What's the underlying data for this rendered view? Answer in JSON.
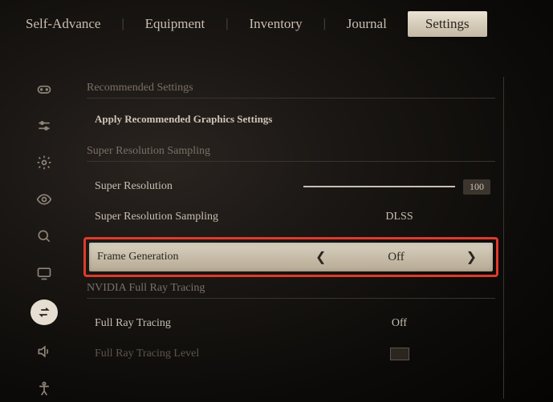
{
  "tabs": {
    "items": [
      "Self-Advance",
      "Equipment",
      "Inventory",
      "Journal",
      "Settings"
    ],
    "active": 4
  },
  "sidebar_icons": [
    "controller",
    "sliders",
    "gear",
    "eye",
    "search",
    "display",
    "swap",
    "audio",
    "accessibility"
  ],
  "sections": {
    "recommended": {
      "header": "Recommended Settings",
      "apply": "Apply Recommended Graphics Settings"
    },
    "srs": {
      "header": "Super Resolution Sampling",
      "rows": {
        "super_resolution": {
          "label": "Super Resolution",
          "value": "100"
        },
        "srs_mode": {
          "label": "Super Resolution Sampling",
          "value": "DLSS"
        },
        "frame_gen": {
          "label": "Frame Generation",
          "value": "Off"
        }
      }
    },
    "rt": {
      "header": "NVIDIA Full Ray Tracing",
      "rows": {
        "full_rt": {
          "label": "Full Ray Tracing",
          "value": "Off"
        },
        "rt_level": {
          "label": "Full Ray Tracing Level",
          "value": ""
        }
      }
    }
  }
}
